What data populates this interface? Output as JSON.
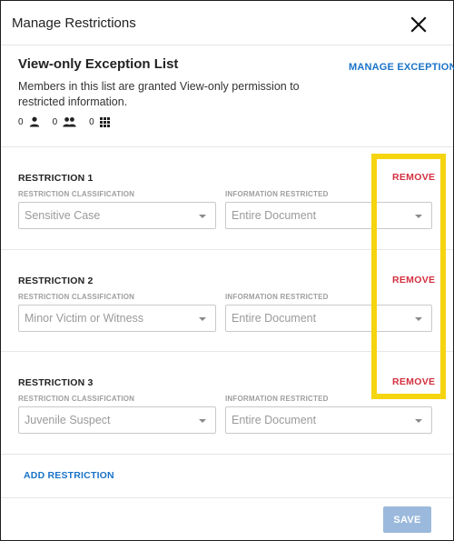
{
  "dialog": {
    "title": "Manage Restrictions",
    "close_icon": "close-icon"
  },
  "exception_list": {
    "title": "View-only Exception List",
    "manage_label": "MANAGE EXCEPTIONS",
    "description": "Members in this list are granted View-only permission to restricted information.",
    "counts": [
      {
        "value": "0",
        "icon": "person-icon"
      },
      {
        "value": "0",
        "icon": "group-icon"
      },
      {
        "value": "0",
        "icon": "apps-grid-icon"
      }
    ]
  },
  "field_labels": {
    "classification": "RESTRICTION CLASSIFICATION",
    "info": "INFORMATION RESTRICTED"
  },
  "restrictions": [
    {
      "title": "RESTRICTION 1",
      "remove_label": "REMOVE",
      "classification": "Sensitive Case",
      "info": "Entire Document"
    },
    {
      "title": "RESTRICTION 2",
      "remove_label": "REMOVE",
      "classification": "Minor Victim or Witness",
      "info": "Entire Document"
    },
    {
      "title": "RESTRICTION 3",
      "remove_label": "REMOVE",
      "classification": "Juvenile Suspect",
      "info": "Entire Document"
    }
  ],
  "footer": {
    "add_label": "ADD RESTRICTION",
    "save_label": "SAVE"
  },
  "colors": {
    "link": "#1a73c8",
    "remove": "#d32f3f",
    "save_disabled": "#9bb9dc",
    "highlight": "#f5d410"
  }
}
